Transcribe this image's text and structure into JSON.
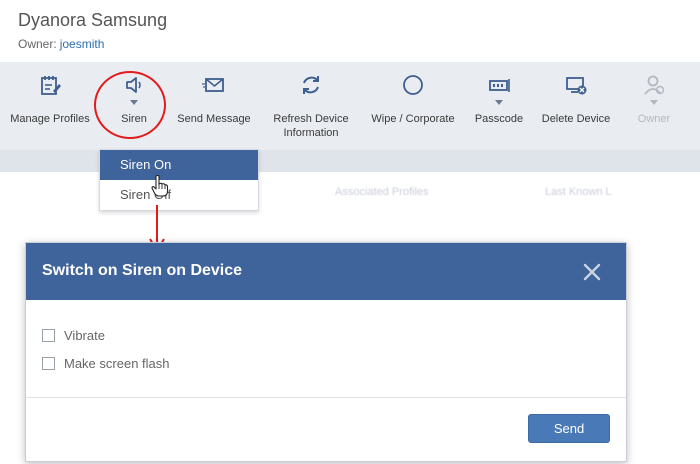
{
  "device": {
    "name": "Dyanora Samsung",
    "owner_label": "Owner:",
    "owner_name": "joesmith"
  },
  "toolbar": {
    "items": [
      {
        "label": "Manage Profiles",
        "icon": "manage-profiles-icon",
        "dropdown": false
      },
      {
        "label": "Siren",
        "icon": "speaker-icon",
        "dropdown": true
      },
      {
        "label": "Send Message",
        "icon": "envelope-icon",
        "dropdown": false
      },
      {
        "label": "Refresh Device Information",
        "icon": "refresh-icon",
        "dropdown": false
      },
      {
        "label": "Wipe / Corporate",
        "icon": "circle-icon",
        "dropdown": false
      },
      {
        "label": "Passcode",
        "icon": "passcode-icon",
        "dropdown": true
      },
      {
        "label": "Delete Device",
        "icon": "delete-device-icon",
        "dropdown": false
      },
      {
        "label": "Owner",
        "icon": "user-icon",
        "dropdown": true,
        "disabled": true
      }
    ]
  },
  "background_tabs": [
    "Associated Profiles",
    "Last Known L"
  ],
  "siren_menu": {
    "items": [
      "Siren On",
      "Siren Off"
    ],
    "highlighted": "Siren On"
  },
  "modal": {
    "title": "Switch on Siren on Device",
    "options": [
      {
        "label": "Vibrate",
        "checked": false
      },
      {
        "label": "Make screen flash",
        "checked": false
      }
    ],
    "send_label": "Send"
  },
  "colors": {
    "accent": "#3f639b",
    "button": "#4a79b7",
    "annotation": "#e21b1b",
    "toolbar_bg": "#e9ecf1"
  }
}
